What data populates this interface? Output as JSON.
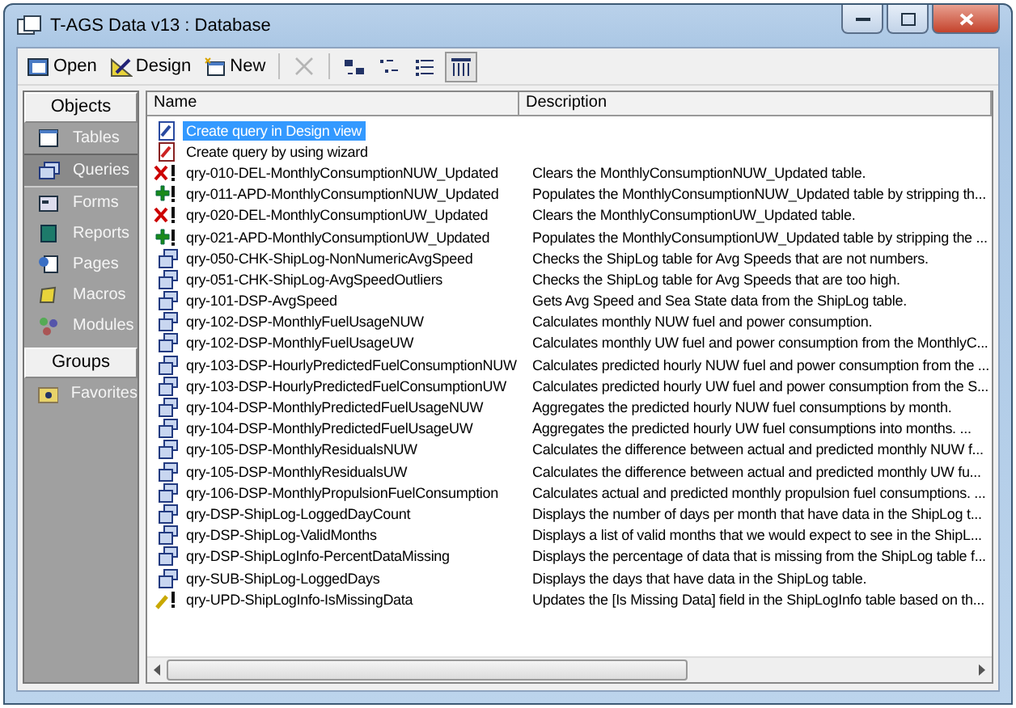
{
  "window": {
    "title": "T-AGS Data v13 : Database"
  },
  "toolbar": {
    "buttons": [
      {
        "kind": "open",
        "label": "Open"
      },
      {
        "kind": "design",
        "label": "Design"
      },
      {
        "kind": "new",
        "label": "New"
      }
    ],
    "delete_disabled": true,
    "views": [
      {
        "kind": "large",
        "selected": false
      },
      {
        "kind": "small",
        "selected": false
      },
      {
        "kind": "list",
        "selected": false
      },
      {
        "kind": "details",
        "selected": true
      }
    ]
  },
  "sidebar": {
    "objects_label": "Objects",
    "items": [
      {
        "kind": "tables",
        "label": "Tables",
        "selected": false
      },
      {
        "kind": "queries",
        "label": "Queries",
        "selected": true
      },
      {
        "kind": "forms",
        "label": "Forms",
        "selected": false
      },
      {
        "kind": "reports",
        "label": "Reports",
        "selected": false
      },
      {
        "kind": "pages",
        "label": "Pages",
        "selected": false
      },
      {
        "kind": "macros",
        "label": "Macros",
        "selected": false
      },
      {
        "kind": "modules",
        "label": "Modules",
        "selected": false
      }
    ],
    "groups_label": "Groups",
    "groups": [
      {
        "label": "Favorites"
      }
    ]
  },
  "table": {
    "columns": [
      "Name",
      "Description"
    ],
    "rows": [
      {
        "kind": "design",
        "name": "Create query in Design view",
        "selected": true
      },
      {
        "kind": "wizard",
        "name": "Create query by using wizard",
        "selected": false
      },
      {
        "kind": "delete",
        "name": "qry-010-DEL-MonthlyConsumptionNUW_Updated",
        "description": "Clears the MonthlyConsumptionNUW_Updated table.",
        "selected": false
      },
      {
        "kind": "append",
        "name": "qry-011-APD-MonthlyConsumptionNUW_Updated",
        "description": "Populates the MonthlyConsumptionNUW_Updated table by stripping th...",
        "selected": false
      },
      {
        "kind": "delete",
        "name": "qry-020-DEL-MonthlyConsumptionUW_Updated",
        "description": "Clears the MonthlyConsumptionUW_Updated table.",
        "selected": false
      },
      {
        "kind": "append",
        "name": "qry-021-APD-MonthlyConsumptionUW_Updated",
        "description": "Populates the MonthlyConsumptionUW_Updated table by stripping the ...",
        "selected": false
      },
      {
        "kind": "select",
        "name": "qry-050-CHK-ShipLog-NonNumericAvgSpeed",
        "description": "Checks the ShipLog table for Avg Speeds that are not numbers.",
        "selected": false
      },
      {
        "kind": "select",
        "name": "qry-051-CHK-ShipLog-AvgSpeedOutliers",
        "description": "Checks the ShipLog table for Avg Speeds that are too high.",
        "selected": false
      },
      {
        "kind": "select",
        "name": "qry-101-DSP-AvgSpeed",
        "description": "Gets Avg Speed and Sea State data from the ShipLog table.",
        "selected": false
      },
      {
        "kind": "select",
        "name": "qry-102-DSP-MonthlyFuelUsageNUW",
        "description": "Calculates monthly NUW fuel and power consumption.",
        "selected": false
      },
      {
        "kind": "select",
        "name": "qry-102-DSP-MonthlyFuelUsageUW",
        "description": "Calculates monthly UW fuel and power consumption from the MonthlyC...",
        "selected": false
      },
      {
        "kind": "select",
        "name": "qry-103-DSP-HourlyPredictedFuelConsumptionNUW",
        "description": "Calculates predicted hourly NUW fuel and power consumption from the ...",
        "selected": false
      },
      {
        "kind": "select",
        "name": "qry-103-DSP-HourlyPredictedFuelConsumptionUW",
        "description": "Calculates predicted hourly UW fuel and power consumption from the S...",
        "selected": false
      },
      {
        "kind": "select",
        "name": "qry-104-DSP-MonthlyPredictedFuelUsageNUW",
        "description": "Aggregates the predicted hourly NUW fuel consumptions by month.",
        "selected": false
      },
      {
        "kind": "select",
        "name": "qry-104-DSP-MonthlyPredictedFuelUsageUW",
        "description": "Aggregates the predicted hourly UW fuel consumptions into months.  ...",
        "selected": false
      },
      {
        "kind": "select",
        "name": "qry-105-DSP-MonthlyResidualsNUW",
        "description": "Calculates the difference between actual and predicted monthly NUW f...",
        "selected": false
      },
      {
        "kind": "select",
        "name": "qry-105-DSP-MonthlyResidualsUW",
        "description": "Calculates the difference between actual and predicted monthly UW fu...",
        "selected": false
      },
      {
        "kind": "select",
        "name": "qry-106-DSP-MonthlyPropulsionFuelConsumption",
        "description": "Calculates actual and predicted monthly propulsion fuel consumptions.  ...",
        "selected": false
      },
      {
        "kind": "select",
        "name": "qry-DSP-ShipLog-LoggedDayCount",
        "description": "Displays the number of days per month that have data in the ShipLog t...",
        "selected": false
      },
      {
        "kind": "select",
        "name": "qry-DSP-ShipLog-ValidMonths",
        "description": "Displays a list of valid months that we would expect to see in the ShipL...",
        "selected": false
      },
      {
        "kind": "select",
        "name": "qry-DSP-ShipLogInfo-PercentDataMissing",
        "description": "Displays the percentage of data that is missing from the ShipLog table f...",
        "selected": false
      },
      {
        "kind": "select",
        "name": "qry-SUB-ShipLog-LoggedDays",
        "description": "Displays the days that have data in the ShipLog table.",
        "selected": false
      },
      {
        "kind": "update",
        "name": "qry-UPD-ShipLogInfo-IsMissingData",
        "description": "Updates the [Is Missing Data] field in the ShipLogInfo table based on th...",
        "selected": false
      }
    ]
  }
}
